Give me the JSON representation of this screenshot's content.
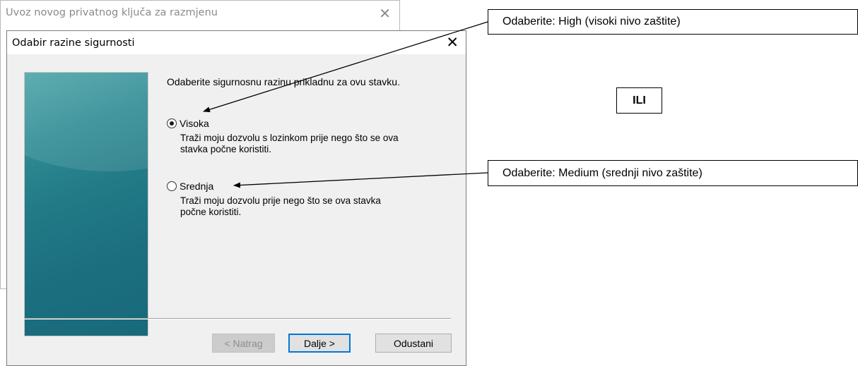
{
  "background_window": {
    "title": "Uvoz novog privatnog ključa za razmjenu",
    "close_icon": "close-icon"
  },
  "dialog": {
    "title": "Odabir razine sigurnosti",
    "close_icon": "close-icon",
    "instruction": "Odaberite sigurnosnu razinu prikladnu za ovu stavku.",
    "options": [
      {
        "label": "Visoka",
        "selected": true,
        "description_line1": "Traži moju dozvolu s lozinkom prije nego što se ova",
        "description_line2": "stavka počne koristiti."
      },
      {
        "label": "Srednja",
        "selected": false,
        "description_line1": "Traži moju dozvolu prije nego što se ova stavka",
        "description_line2": "počne koristiti."
      }
    ],
    "buttons": {
      "back": "< Natrag",
      "next": "Dalje >",
      "cancel": "Odustani"
    }
  },
  "annotations": {
    "callout_high": "Odaberite: High (visoki nivo zaštite)",
    "callout_medium": "Odaberite: Medium (srednji nivo zaštite)",
    "or_label": "ILI"
  },
  "colors": {
    "side_panel": "#227b87",
    "default_button_border": "#0078d7"
  }
}
